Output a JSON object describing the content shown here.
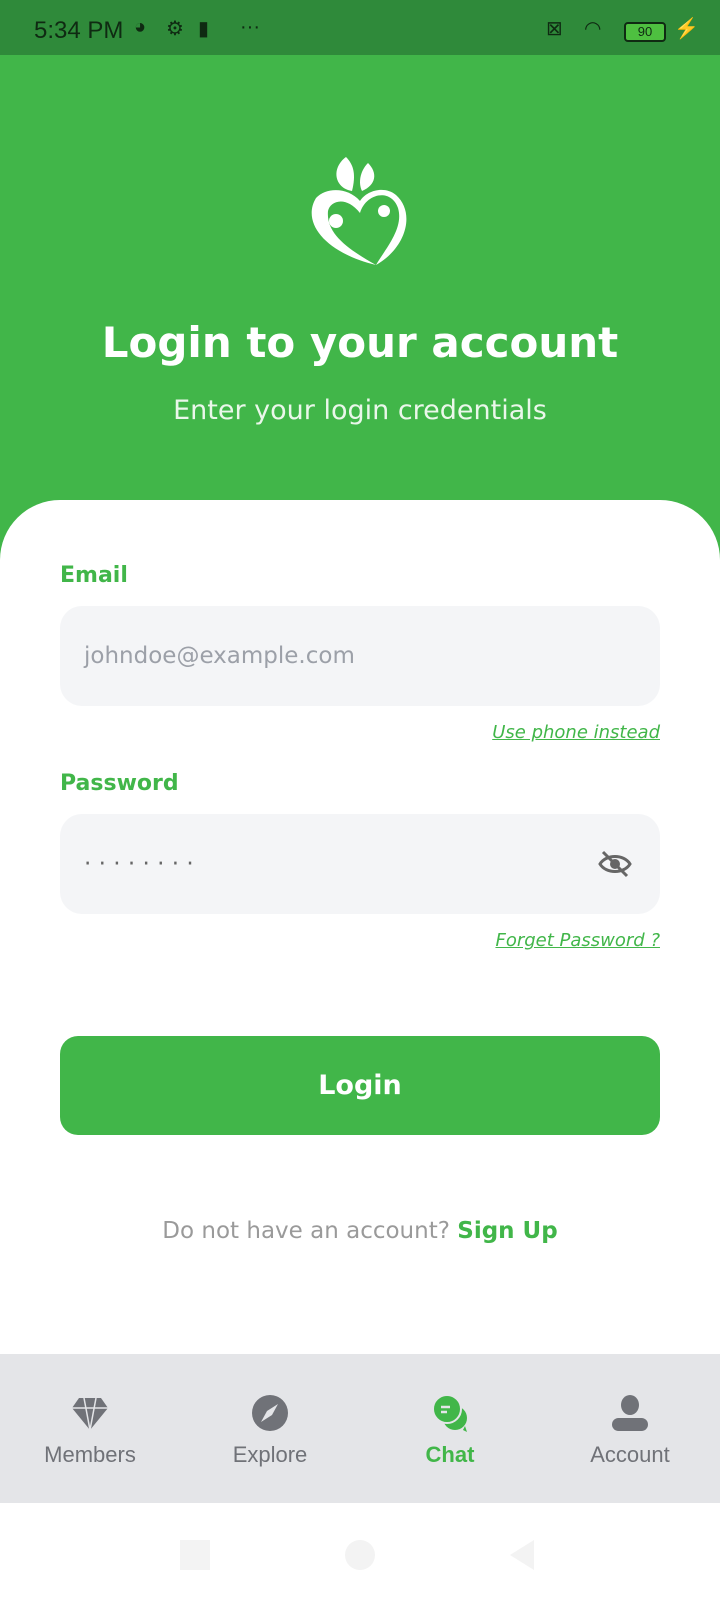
{
  "status": {
    "time": "5:34 PM",
    "battery": "90"
  },
  "header": {
    "title": "Login to your account",
    "subtitle": "Enter your login credentials"
  },
  "form": {
    "email_label": "Email",
    "email_placeholder": "johndoe@example.com",
    "use_phone": "Use phone instead",
    "password_label": "Password",
    "password_value": "· · · · · · · ·",
    "forgot": "Forget Password ?",
    "login": "Login",
    "no_account": "Do not have an account?",
    "signup": "Sign Up"
  },
  "tabs": [
    {
      "label": "Members",
      "icon": "diamond-icon"
    },
    {
      "label": "Explore",
      "icon": "compass-icon"
    },
    {
      "label": "Chat",
      "icon": "chat-icon",
      "active": true
    },
    {
      "label": "Account",
      "icon": "person-icon"
    }
  ],
  "colors": {
    "brand": "#41b649",
    "status_bar": "#2f8a3a",
    "tabbar": "#e4e5e8",
    "inactive": "#707278"
  }
}
